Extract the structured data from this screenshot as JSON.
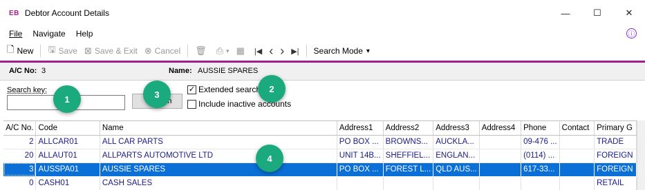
{
  "window": {
    "app_icon": "EB",
    "title": "Debtor Account Details",
    "controls": {
      "minimize": "—",
      "maximize": "☐",
      "close": "✕"
    }
  },
  "menu": [
    "File",
    "Navigate",
    "Help"
  ],
  "info_icon": "ⓘ",
  "toolbar": {
    "new_label": "New",
    "save_label": "Save",
    "save_exit_label": "Save & Exit",
    "cancel_label": "Cancel",
    "nav_first": "|◀",
    "nav_prev": "‹",
    "nav_next": "›",
    "nav_last": "▶|",
    "search_mode_label": "Search Mode",
    "search_mode_caret": "▾"
  },
  "account": {
    "ac_no_label": "A/C No:",
    "ac_no_value": "3",
    "name_label": "Name:",
    "name_value": "AUSSIE SPARES"
  },
  "search": {
    "key_label": "Search key:",
    "key_value": "",
    "button_label": "ch",
    "extended_label": "Extended search",
    "extended_checked": true,
    "inactive_label": "Include inactive accounts",
    "inactive_checked": false
  },
  "grid": {
    "columns": [
      "A/C No.",
      "Code",
      "Name",
      "Address1",
      "Address2",
      "Address3",
      "Address4",
      "Phone",
      "Contact",
      "Primary G"
    ],
    "rows": [
      [
        "2",
        "ALLCAR01",
        "ALL CAR PARTS",
        "PO BOX ...",
        "BROWNS...",
        "AUCKLA...",
        "",
        "09-476 ...",
        "",
        "TRADE"
      ],
      [
        "20",
        "ALLAUT01",
        "ALLPARTS AUTOMOTIVE LTD",
        "UNIT 14B...",
        "SHEFFIEL...",
        "ENGLAN...",
        "",
        "(0114) ...",
        "",
        "FOREIGN"
      ],
      [
        "3",
        "AUSSPA01",
        "AUSSIE SPARES",
        "PO BOX ...",
        "FOREST L...",
        "QLD AUS...",
        "",
        "617-33...",
        "",
        "FOREIGN"
      ],
      [
        "0",
        "CASH01",
        "CASH SALES",
        "",
        "",
        "",
        "",
        "",
        "",
        "RETAIL"
      ]
    ],
    "selected_row": 2
  },
  "markers": [
    "1",
    "2",
    "3",
    "4"
  ],
  "colors": {
    "accent": "#a0208a",
    "selection": "#0a6fd6",
    "marker": "#1aaa7e",
    "link_text": "#1a1a8c"
  }
}
